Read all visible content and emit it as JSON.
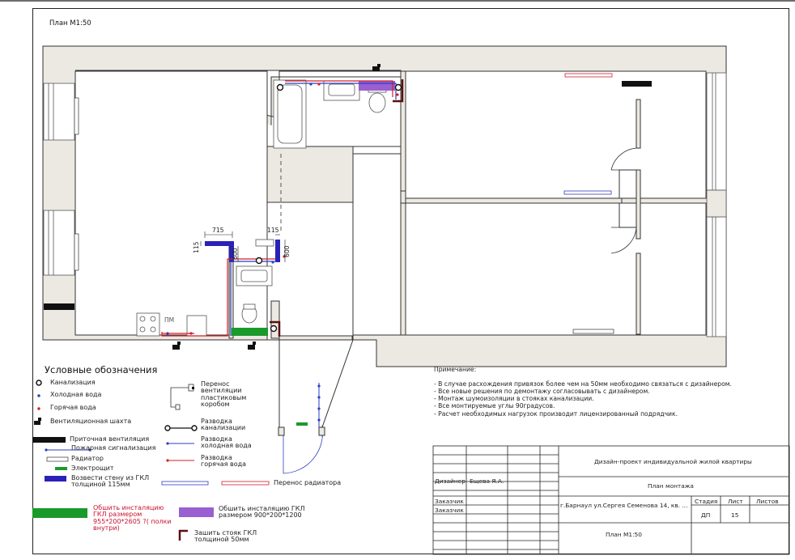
{
  "plan_title": "План М1:50",
  "dimensions": {
    "vent_box_width": "715",
    "vent_box_thickness": "115",
    "vent_box_depth_left": "600",
    "bath_box_thickness": "115",
    "bath_box_depth": "600"
  },
  "fixture_labels": {
    "pm": "ПМ"
  },
  "legend": {
    "title": "Условные обозначения",
    "items": [
      {
        "key": "sewer",
        "label": "Канализация"
      },
      {
        "key": "cold",
        "label": "Холодная вода"
      },
      {
        "key": "hot",
        "label": "Горячая вода"
      },
      {
        "key": "vent_shaft",
        "label": "Вентиляционная шахта"
      },
      {
        "key": "supply_vent",
        "label": "Приточная вентиляция"
      },
      {
        "key": "fire_alarm",
        "label": "Пожарная сигнализация"
      },
      {
        "key": "radiator",
        "label": "Радиатор"
      },
      {
        "key": "panel",
        "label": "Электрощит"
      },
      {
        "key": "gkl_wall",
        "label": "Возвести стену из ГКЛ толщиной 115мм"
      },
      {
        "key": "gkl_box_green",
        "label": "Обшить инсталяцию ГКЛ размером 955*200*2605 ?( полки внутри)"
      },
      {
        "key": "plastic_box",
        "label": "Перенос вентиляции пластиковым коробом"
      },
      {
        "key": "sewer_route",
        "label": "Разводка канализации"
      },
      {
        "key": "cold_route",
        "label": "Разводка холодная вода"
      },
      {
        "key": "hot_route",
        "label": "Разводка горячая вода"
      },
      {
        "key": "radiator_move",
        "label": "Перенос радиатора"
      },
      {
        "key": "gkl_box_purple",
        "label": "Обшить инсталяцию ГКЛ размером 900*200*1200"
      },
      {
        "key": "riser_box",
        "label": "Зашить стояк ГКЛ толщиной 50мм"
      }
    ]
  },
  "notes": {
    "heading": "Примечание:",
    "items": [
      "В случае расхождения привязок более чем на 50мм необходимо связаться с дизайнером.",
      "Все новые решения по демонтажу согласовывать с дизайнером.",
      "Монтаж шумоизоляции в стояках канализации.",
      "Все монтируемые углы 90градусов.",
      "Расчет необходимых нагрузок производит лицензированный подрядчик."
    ]
  },
  "title_block": {
    "project": "Дизайн-проект индивидуальной жилой квартиры",
    "sheet_name": "План монтажа",
    "role_designer": "Дизайнер",
    "designer": "Ещева Я.А.",
    "role_client_1": "Заказчик",
    "role_client_2": "Заказчик",
    "address": "г.Барнаул ул.Сергея Семенова 14, кв. ...",
    "stage_header": "Стадия",
    "sheet_header": "Лист",
    "sheets_header": "Листов",
    "stage": "ДП",
    "sheet_no": "15",
    "sheets_total": "",
    "scale_label": "План М1:50"
  },
  "colors": {
    "wall_fill": "#ece9e2",
    "cold_water": "#2b3fbf",
    "hot_water": "#d21f2a",
    "gkl_wall": "#2a21b8",
    "gkl_green": "#1a9a2a",
    "gkl_purple": "#9a5fd1",
    "riser": "#5a1010"
  }
}
